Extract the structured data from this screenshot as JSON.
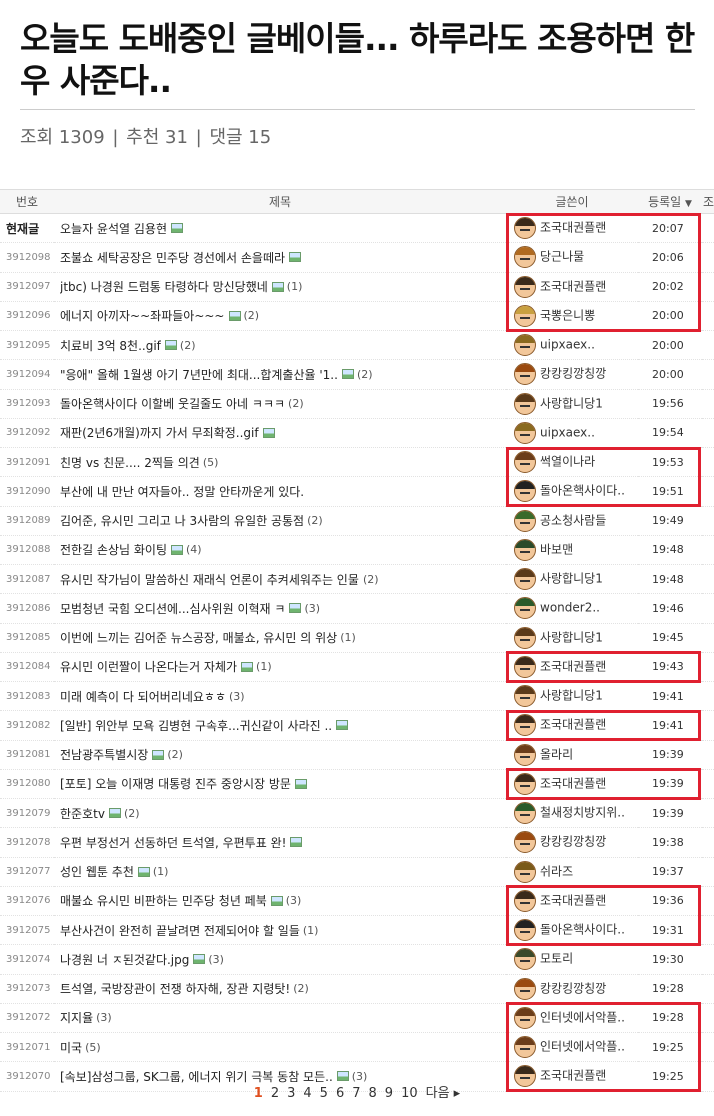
{
  "post": {
    "title": "오늘도 도배중인 글베이들... 하루라도 조용하면 한우 사준다..",
    "meta": {
      "views": "조회 1309",
      "sep1": " | ",
      "recommends": "추천 31",
      "sep2": " | ",
      "comments": "댓글 15"
    }
  },
  "table": {
    "headers": {
      "no": "번호",
      "subject": "제목",
      "writer": "글쓴이",
      "date": "등록일",
      "extra": "조"
    },
    "rows": [
      {
        "no": "현재글",
        "subject": "오늘자 윤석열 김용현",
        "img": true,
        "comments": "",
        "writer": "조국대권플랜",
        "date": "20:07",
        "current": true,
        "hair": "#3a2a1a"
      },
      {
        "no": "3912098",
        "subject": "조불쇼 세탁공장은 민주당 경선에서 손을떼라",
        "img": true,
        "comments": "",
        "writer": "당근나물",
        "date": "20:06",
        "hair": "#b06a20"
      },
      {
        "no": "3912097",
        "subject": "jtbc) 나경원 드럼통 타령하다 망신당했네",
        "img": true,
        "comments": "(1)",
        "writer": "조국대권플랜",
        "date": "20:02",
        "hair": "#3a2a1a"
      },
      {
        "no": "3912096",
        "subject": "에너지 아끼자~~좌파들아~~~",
        "img": true,
        "comments": "(2)",
        "writer": "국뽕은니뽕",
        "date": "20:00",
        "hair": "#c8a040"
      },
      {
        "no": "3912095",
        "subject": "치료비 3억 8천..gif",
        "img": true,
        "comments": "(2)",
        "writer": "uipxaex..",
        "date": "20:00",
        "hair": "#8a6a20"
      },
      {
        "no": "3912094",
        "subject": "\"응애\" 올해 1월생 아기 7년만에 최대...합계출산율 '1..",
        "img": true,
        "comments": "(2)",
        "writer": "캉캉킹깡칭깡",
        "date": "20:00",
        "hair": "#9a4a10"
      },
      {
        "no": "3912093",
        "subject": "돌아온핵사이다 이할베 웃길줄도 아네 ㅋㅋㅋ",
        "img": false,
        "comments": "(2)",
        "writer": "사랑합니당1",
        "date": "19:56",
        "hair": "#5a3a1a"
      },
      {
        "no": "3912092",
        "subject": "재판(2년6개월)까지 가서 무죄확정..gif",
        "img": true,
        "comments": "",
        "writer": "uipxaex..",
        "date": "19:54",
        "hair": "#8a6a20"
      },
      {
        "no": "3912091",
        "subject": "친명 vs 친문.... 2찍들 의견",
        "img": false,
        "comments": "(5)",
        "writer": "썩열이나라",
        "date": "19:53",
        "hair": "#6b3d1a"
      },
      {
        "no": "3912090",
        "subject": "부산에 내 만난 여자들아.. 정말 안타까운게 있다.",
        "img": false,
        "comments": "",
        "writer": "돌아온핵사이다..",
        "date": "19:51",
        "hair": "#222"
      },
      {
        "no": "3912089",
        "subject": "김어준, 유시민 그리고 나 3사람의 유일한 공통점",
        "img": false,
        "comments": "(2)",
        "writer": "공소청사람들",
        "date": "19:49",
        "hair": "#3a6a2a"
      },
      {
        "no": "3912088",
        "subject": "전한길 손상님 화이팅",
        "img": true,
        "comments": "(4)",
        "writer": "바보맨",
        "date": "19:48",
        "hair": "#2a4a2a"
      },
      {
        "no": "3912087",
        "subject": "유시민 작가님이 말씀하신 재래식 언론이 추켜세워주는 인물..",
        "img": false,
        "comments": "(2)",
        "writer": "사랑합니당1",
        "date": "19:48",
        "hair": "#5a3a1a"
      },
      {
        "no": "3912086",
        "subject": "모범청년 국힘 오디션에...심사위원 이혁재 ㅋ",
        "img": true,
        "comments": "(3)",
        "writer": "wonder2..",
        "date": "19:46",
        "hair": "#2a5a2a"
      },
      {
        "no": "3912085",
        "subject": "이번에 느끼는 김어준 뉴스공장, 매불쇼, 유시민 의 위상",
        "img": false,
        "comments": "(1)",
        "writer": "사랑합니당1",
        "date": "19:45",
        "hair": "#5a3a1a"
      },
      {
        "no": "3912084",
        "subject": "유시민 이런짤이 나온다는거 자체가",
        "img": true,
        "comments": "(1)",
        "writer": "조국대권플랜",
        "date": "19:43",
        "hair": "#3a2a1a"
      },
      {
        "no": "3912083",
        "subject": "미래 예측이 다 되어버리네요ㅎㅎ",
        "img": false,
        "comments": "(3)",
        "writer": "사랑합니당1",
        "date": "19:41",
        "hair": "#5a3a1a"
      },
      {
        "no": "3912082",
        "subject": "[일반] 위안부 모욕 김병현 구속후...귀신같이 사라진 ..",
        "img": true,
        "comments": "",
        "writer": "조국대권플랜",
        "date": "19:41",
        "hair": "#3a2a1a"
      },
      {
        "no": "3912081",
        "subject": "전남광주특별시장",
        "img": true,
        "comments": "(2)",
        "writer": "올라리",
        "date": "19:39",
        "hair": "#6b3d1a"
      },
      {
        "no": "3912080",
        "subject": "[포토] 오늘 이재명 대통령 진주 중앙시장 방문",
        "img": true,
        "comments": "",
        "writer": "조국대권플랜",
        "date": "19:39",
        "hair": "#3a2a1a"
      },
      {
        "no": "3912079",
        "subject": "한준호tv",
        "img": true,
        "comments": "(2)",
        "writer": "철새정치방지위..",
        "date": "19:39",
        "hair": "#2a5a2a"
      },
      {
        "no": "3912078",
        "subject": "우편 부정선거 선동하던 트석열, 우편투표 완!",
        "img": true,
        "comments": "",
        "writer": "캉캉킹깡칭깡",
        "date": "19:38",
        "hair": "#9a4a10"
      },
      {
        "no": "3912077",
        "subject": "성인 웹툰 추천",
        "img": true,
        "comments": "(1)",
        "writer": "쉬라즈",
        "date": "19:37",
        "hair": "#7a5a1a"
      },
      {
        "no": "3912076",
        "subject": "매불쇼 유시민 비판하는 민주당 청년 페북",
        "img": true,
        "comments": "(3)",
        "writer": "조국대권플랜",
        "date": "19:36",
        "hair": "#3a2a1a"
      },
      {
        "no": "3912075",
        "subject": "부산사건이 완전히 끝날려면 전제되어야 할 일들",
        "img": false,
        "comments": "(1)",
        "writer": "돌아온핵사이다..",
        "date": "19:31",
        "hair": "#222"
      },
      {
        "no": "3912074",
        "subject": "나경원 너 ㅈ된것같다.jpg",
        "img": true,
        "comments": "(3)",
        "writer": "모토리",
        "date": "19:30",
        "hair": "#3a4a2a"
      },
      {
        "no": "3912073",
        "subject": "트석열, 국방장관이 전쟁 하자해, 장관 지령탓!",
        "img": false,
        "comments": "(2)",
        "writer": "캉캉킹깡칭깡",
        "date": "19:28",
        "hair": "#9a4a10"
      },
      {
        "no": "3912072",
        "subject": "지지율",
        "img": false,
        "comments": "(3)",
        "writer": "인터넷에서악플..",
        "date": "19:28",
        "hair": "#6b3d1a"
      },
      {
        "no": "3912071",
        "subject": "미국",
        "img": false,
        "comments": "(5)",
        "writer": "인터넷에서악플..",
        "date": "19:25",
        "hair": "#6b3d1a"
      },
      {
        "no": "3912070",
        "subject": "[속보]삼성그룹, SK그룹, 에너지 위기 극복 동참 모든..",
        "img": true,
        "comments": "(3)",
        "writer": "조국대권플랜",
        "date": "19:25",
        "hair": "#3a2a1a"
      }
    ]
  },
  "pager": {
    "pages": [
      "1",
      "2",
      "3",
      "4",
      "5",
      "6",
      "7",
      "8",
      "9",
      "10"
    ],
    "next": "다음 ▸",
    "current": "1"
  },
  "colors": {
    "highlight": "#e02030",
    "current_page": "#e05020"
  }
}
